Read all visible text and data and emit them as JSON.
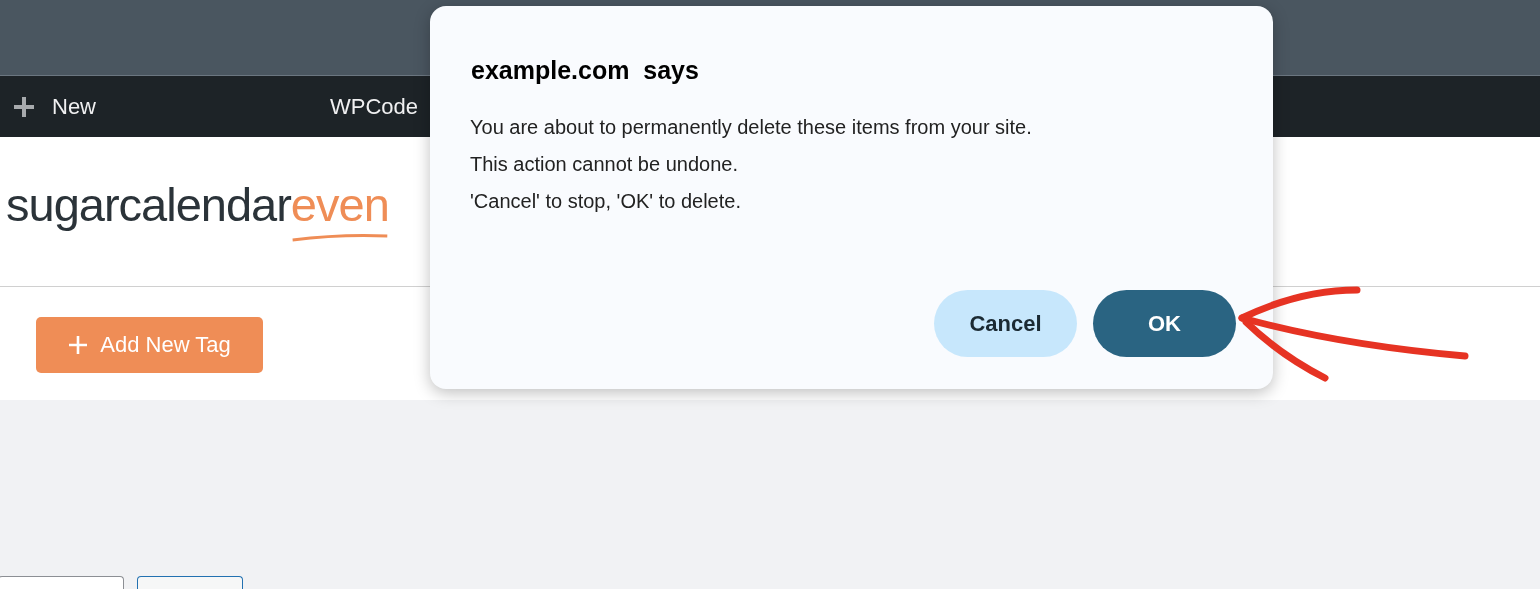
{
  "admin_bar": {
    "items": [
      {
        "kind": "new",
        "label": "New"
      },
      {
        "kind": "plain",
        "label": "WPCode"
      }
    ]
  },
  "logo": {
    "main": "sugarcalendar",
    "accent": "even"
  },
  "add_button": {
    "label": "Add New Tag"
  },
  "dialog": {
    "title": "example.com  says",
    "lines": [
      "You are about to permanently delete these items from your site.",
      "This action cannot be undone.",
      "'Cancel' to stop, 'OK' to delete."
    ],
    "buttons": [
      {
        "kind": "secondary",
        "label": "Cancel"
      },
      {
        "kind": "primary",
        "label": "OK"
      }
    ]
  }
}
